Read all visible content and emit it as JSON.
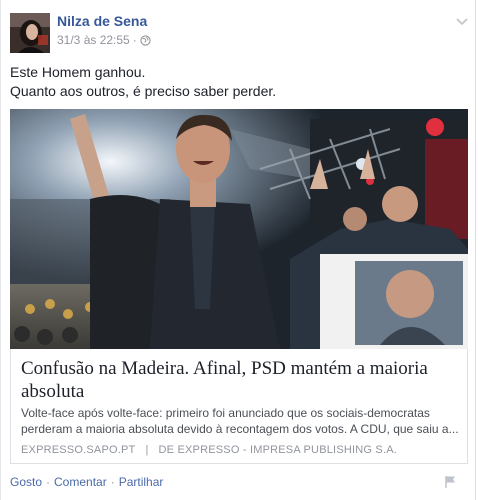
{
  "post": {
    "author": "Nilza de Sena",
    "timestamp": "31/3 às 22:55",
    "separator": "·",
    "privacy_icon": "globe-icon",
    "menu_icon": "chevron-down-icon",
    "text_line1": "Este Homem ganhou.",
    "text_line2": "Quanto aos outros, é preciso saber perder."
  },
  "link_card": {
    "title": "Confusão na Madeira. Afinal, PSD mantém a maioria absoluta",
    "description": "Volte-face após volte-face: primeiro foi anunciado que os sociais-democratas perderam a maioria absoluta devido à recontagem dos votos. A CDU, que saiu a...",
    "domain": "EXPRESSO.SAPO.PT",
    "divider": "|",
    "publisher": "DE EXPRESSO - IMPRESA PUBLISHING S.A."
  },
  "actions": {
    "like": "Gosto",
    "comment": "Comentar",
    "share": "Partilhar",
    "dot": "·",
    "report_icon": "flag-icon"
  },
  "colors": {
    "link_blue": "#365899",
    "meta_gray": "#90949c",
    "border": "#dddfe2"
  }
}
